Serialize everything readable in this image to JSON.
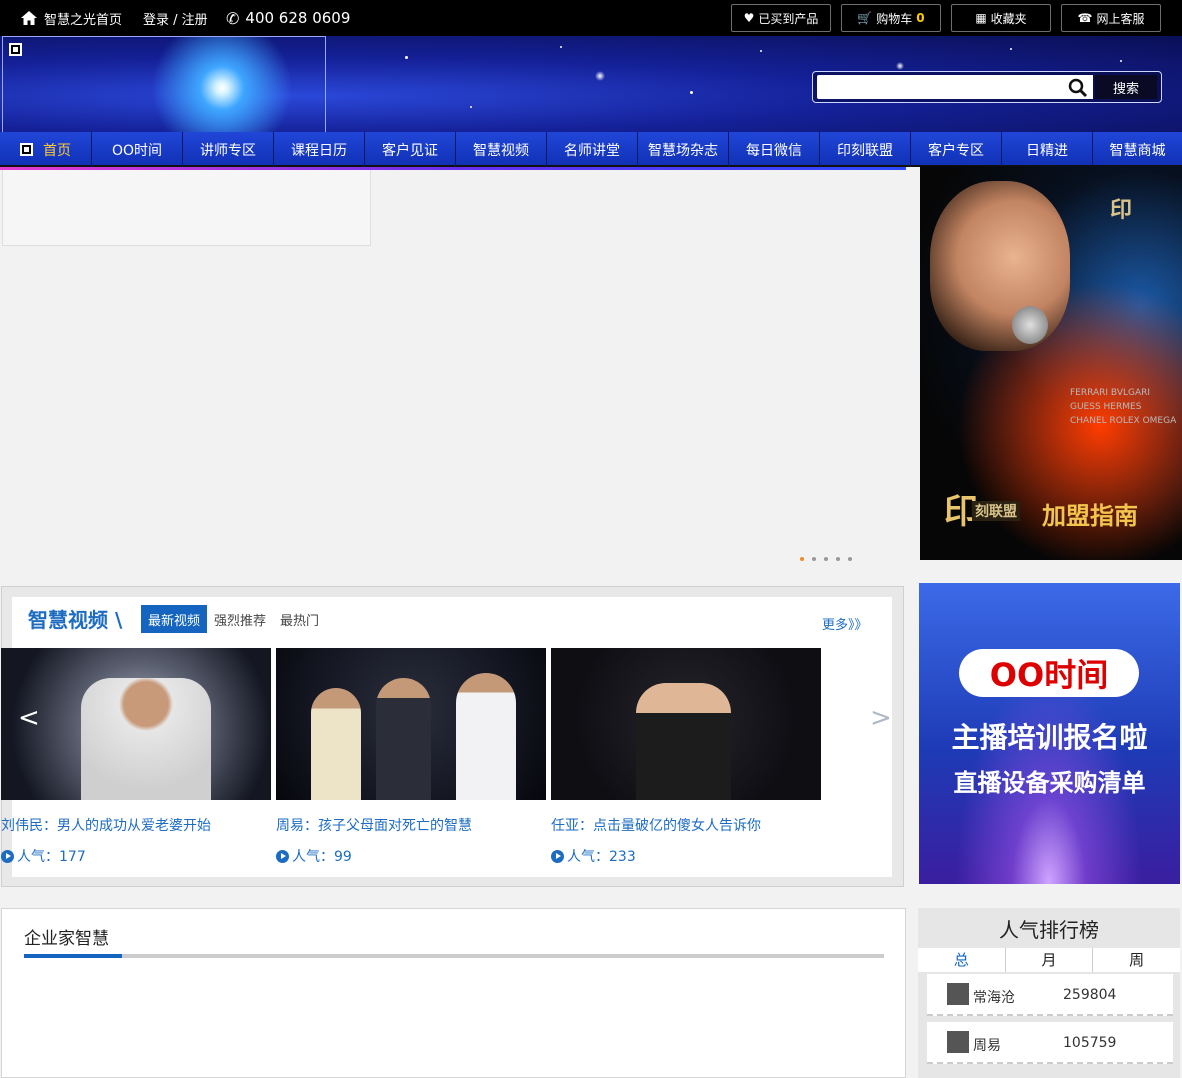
{
  "topbar": {
    "home_label": "智慧之光首页",
    "login_label": "登录 / 注册",
    "phone": "400 628 0609",
    "buttons": {
      "bought": "已买到产品",
      "cart": "购物车",
      "cart_count": "0",
      "favorites": "收藏夹",
      "service": "网上客服"
    }
  },
  "search": {
    "placeholder": "",
    "button_label": "搜索"
  },
  "nav": {
    "items": [
      "首页",
      "OO时间",
      "讲师专区",
      "课程日历",
      "客户见证",
      "智慧视频",
      "名师讲堂",
      "智慧场杂志",
      "每日微信",
      "印刻联盟",
      "客户专区",
      "日精进",
      "智慧商城"
    ],
    "active": "首页"
  },
  "ad1": {
    "logo": "印",
    "brand": "印",
    "brand_sub": "刻联盟",
    "title": "加盟指南",
    "brands": "FERRARI  BVLGARI  GUESS  HERMES  CHANEL  ROLEX  OMEGA"
  },
  "ad2": {
    "logo": "OO时间",
    "line1": "主播培训报名啦",
    "line2": "直播设备采购清单"
  },
  "video_section": {
    "title": "智慧视频 \\",
    "tabs": [
      "最新视频",
      "强烈推荐",
      "最热门"
    ],
    "active_tab": "最新视频",
    "more": "更多》》",
    "arrow_left": "<",
    "arrow_right": ">",
    "videos": [
      {
        "caption": "刘伟民：男人的成功从爱老婆开始",
        "popularity": "人气：177"
      },
      {
        "caption": "周易：孩子父母面对死亡的智慧",
        "popularity": "人气：99"
      },
      {
        "caption": "任亚：点击量破亿的傻女人告诉你",
        "popularity": "人气：233"
      }
    ]
  },
  "enterprise": {
    "title": "企业家智慧"
  },
  "ranking": {
    "title": "人气排行榜",
    "tabs": [
      "总",
      "月",
      "周"
    ],
    "active_tab": "总",
    "rows": [
      {
        "name": "常海沧",
        "value": "259804"
      },
      {
        "name": "周易",
        "value": "105759"
      }
    ]
  },
  "colors": {
    "brand_blue": "#1565c0",
    "nav_blue": "#1d3ec4",
    "active_nav": "#ffcc33",
    "cart_count": "#ffcc00"
  }
}
